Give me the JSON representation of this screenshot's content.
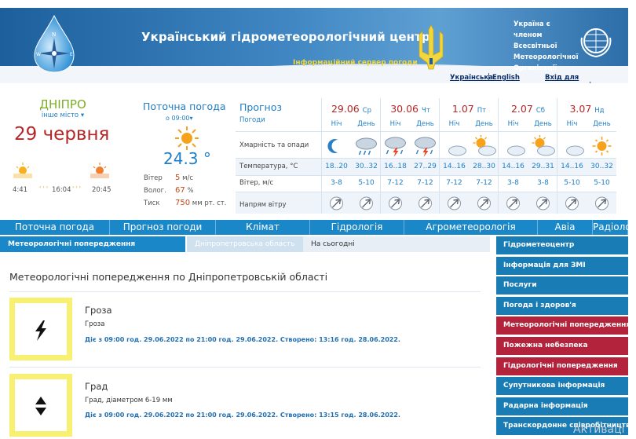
{
  "header": {
    "title": "Український гідрометеорологічний центр",
    "subtitle": "Інформаційний сервер погоди",
    "wmo_text": [
      "Україна є членом",
      "Всесвітньої",
      "Метеорологічної",
      "Організації"
    ],
    "lang_ua": "Українська",
    "lang_sep": "|",
    "lang_en": "English",
    "login": "Вхід для користувачів"
  },
  "city": {
    "name": "ДНІПРО",
    "other": "інше місто",
    "date": "29 червня",
    "sunrise": "4:41",
    "daylength": "16:04",
    "sunset": "20:45"
  },
  "current": {
    "title": "Поточна погода",
    "time": "о 09:00",
    "temp": "24.3 °",
    "wind_label": "Вітер",
    "wind_value": "5",
    "wind_unit": "м/с",
    "hum_label": "Волог.",
    "hum_value": "67",
    "hum_unit": "%",
    "press_label": "Тиск",
    "press_value": "750",
    "press_unit": "мм рт. ст."
  },
  "forecast": {
    "title": "Прогноз",
    "subtitle": "Погоди",
    "row_clouds": "Хмарність та опади",
    "row_temp": "Температура, °C",
    "row_wind": "Вітер, м/с",
    "row_dir": "Напрям вітру",
    "night_label": "Ніч",
    "day_label": "День",
    "days": [
      {
        "date": "29.06",
        "dow": "Ср",
        "t_night": "18..20",
        "t_day": "30..32",
        "w_night": "3-8",
        "w_day": "5-10",
        "i_night": "moon",
        "i_day": "rain"
      },
      {
        "date": "30.06",
        "dow": "Чт",
        "t_night": "16..18",
        "t_day": "27..29",
        "w_night": "7-12",
        "w_day": "7-12",
        "i_night": "storm",
        "i_day": "storm"
      },
      {
        "date": "1.07",
        "dow": "Пт",
        "t_night": "14..16",
        "t_day": "28..30",
        "w_night": "7-12",
        "w_day": "7-12",
        "i_night": "moon-cloud",
        "i_day": "sun-cloud"
      },
      {
        "date": "2.07",
        "dow": "Сб",
        "t_night": "14..16",
        "t_day": "29..31",
        "w_night": "3-8",
        "w_day": "3-8",
        "i_night": "moon-cloud",
        "i_day": "sun-cloud"
      },
      {
        "date": "3.07",
        "dow": "Нд",
        "t_night": "14..16",
        "t_day": "30..32",
        "w_night": "5-10",
        "w_day": "5-10",
        "i_night": "moon-cloud",
        "i_day": "sun"
      }
    ]
  },
  "nav": [
    "Поточна погода",
    "Прогноз погоди",
    "Клімат",
    "Гідрологія",
    "Агрометеорологія",
    "Авіа",
    "Радіологія"
  ],
  "tabs": [
    "Метеорологічні попередження",
    "Дніпропетровська область",
    "На сьогодні"
  ],
  "main": {
    "heading": "Метеорологічні попередження по Дніпропетровській області",
    "warnings": [
      {
        "title": "Гроза",
        "desc": "Гроза",
        "valid": "Діє з 09:00 год. 29.06.2022 по 21:00 год. 29.06.2022. Створено: 13:16 год. 28.06.2022."
      },
      {
        "title": "Град",
        "desc": "Град, діаметром 6-19 мм",
        "valid": "Діє з 09:00 год. 29.06.2022 по 21:00 год. 29.06.2022. Створено: 13:15 год. 28.06.2022."
      }
    ]
  },
  "sidebar": [
    {
      "label": "Гідрометеоцентр",
      "color": "blue"
    },
    {
      "label": "Інформація для ЗМІ",
      "color": "blue"
    },
    {
      "label": "Послуги",
      "color": "blue"
    },
    {
      "label": "Погода і здоров'я",
      "color": "blue"
    },
    {
      "label": "Метеорологічні попередження",
      "color": "red"
    },
    {
      "label": "Пожежна небезпека",
      "color": "red"
    },
    {
      "label": "Гідрологічні попередження",
      "color": "red"
    },
    {
      "label": "Супутникова інформація",
      "color": "blue"
    },
    {
      "label": "Радарна інформація",
      "color": "blue"
    },
    {
      "label": "Транскордонне співробітництво в басейні р. Дністер",
      "color": "blue"
    }
  ],
  "watermark": "Активаці"
}
